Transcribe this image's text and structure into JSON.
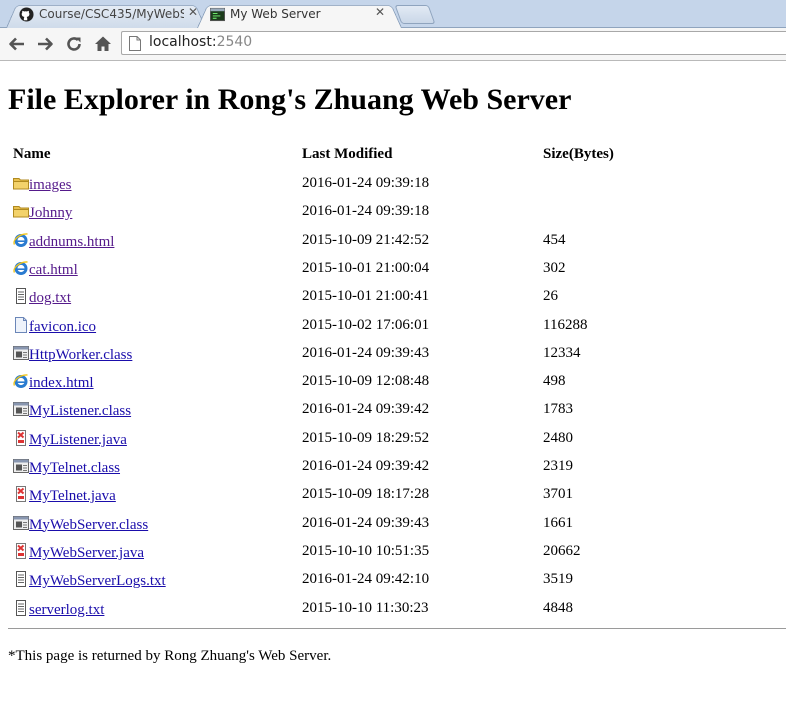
{
  "browser": {
    "tabs": [
      {
        "title": "Course/CSC435/MyWebSe",
        "icon": "github-icon",
        "active": false
      },
      {
        "title": "My Web Server",
        "icon": "terminal-icon",
        "active": true
      }
    ],
    "url_host": "localhost:",
    "url_port": "2540"
  },
  "page": {
    "title": "File Explorer in Rong's Zhuang Web Server",
    "columns": {
      "name": "Name",
      "modified": "Last Modified",
      "size": "Size(Bytes)"
    },
    "footer": "*This page is returned by Rong Zhuang's Web Server."
  },
  "files": [
    {
      "name": "images",
      "modified": "2016-01-24 09:39:18",
      "size": "",
      "icon": "folder-icon",
      "visited": true
    },
    {
      "name": "Johnny",
      "modified": "2016-01-24 09:39:18",
      "size": "",
      "icon": "folder-icon",
      "visited": true
    },
    {
      "name": "addnums.html",
      "modified": "2015-10-09 21:42:52",
      "size": "454",
      "icon": "ie-html-icon",
      "visited": true
    },
    {
      "name": "cat.html",
      "modified": "2015-10-01 21:00:04",
      "size": "302",
      "icon": "ie-html-icon",
      "visited": true
    },
    {
      "name": "dog.txt",
      "modified": "2015-10-01 21:00:41",
      "size": "26",
      "icon": "text-file-icon",
      "visited": true
    },
    {
      "name": "favicon.ico",
      "modified": "2015-10-02 17:06:01",
      "size": "116288",
      "icon": "blank-file-icon",
      "visited": false
    },
    {
      "name": "HttpWorker.class",
      "modified": "2016-01-24 09:39:43",
      "size": "12334",
      "icon": "class-file-icon",
      "visited": false
    },
    {
      "name": "index.html",
      "modified": "2015-10-09 12:08:48",
      "size": "498",
      "icon": "ie-html-icon",
      "visited": false
    },
    {
      "name": "MyListener.class",
      "modified": "2016-01-24 09:39:42",
      "size": "1783",
      "icon": "class-file-icon",
      "visited": false
    },
    {
      "name": "MyListener.java",
      "modified": "2015-10-09 18:29:52",
      "size": "2480",
      "icon": "java-file-icon",
      "visited": false
    },
    {
      "name": "MyTelnet.class",
      "modified": "2016-01-24 09:39:42",
      "size": "2319",
      "icon": "class-file-icon",
      "visited": false
    },
    {
      "name": "MyTelnet.java",
      "modified": "2015-10-09 18:17:28",
      "size": "3701",
      "icon": "java-file-icon",
      "visited": false
    },
    {
      "name": "MyWebServer.class",
      "modified": "2016-01-24 09:39:43",
      "size": "1661",
      "icon": "class-file-icon",
      "visited": false
    },
    {
      "name": "MyWebServer.java",
      "modified": "2015-10-10 10:51:35",
      "size": "20662",
      "icon": "java-file-icon",
      "visited": false
    },
    {
      "name": "MyWebServerLogs.txt",
      "modified": "2016-01-24 09:42:10",
      "size": "3519",
      "icon": "text-file-icon",
      "visited": false
    },
    {
      "name": "serverlog.txt",
      "modified": "2015-10-10 11:30:23",
      "size": "4848",
      "icon": "text-file-icon",
      "visited": false
    }
  ]
}
